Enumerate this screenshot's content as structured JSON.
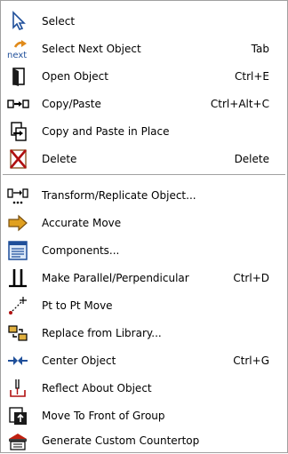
{
  "menu": {
    "items": [
      {
        "label": "Select",
        "shortcut": "",
        "icon": "cursor-arrow-icon"
      },
      {
        "label": "Select Next Object",
        "shortcut": "Tab",
        "icon": "select-next-icon",
        "icon_text": "next"
      },
      {
        "label": "Open Object",
        "shortcut": "Ctrl+E",
        "icon": "open-door-icon"
      },
      {
        "label": "Copy/Paste",
        "shortcut": "Ctrl+Alt+C",
        "icon": "copy-paste-icon"
      },
      {
        "label": "Copy and Paste in Place",
        "shortcut": "",
        "icon": "paste-in-place-icon"
      },
      {
        "label": "Delete",
        "shortcut": "Delete",
        "icon": "delete-icon"
      },
      {
        "label": "Transform/Replicate Object...",
        "shortcut": "",
        "icon": "transform-replicate-icon"
      },
      {
        "label": "Accurate Move",
        "shortcut": "",
        "icon": "arrow-right-icon"
      },
      {
        "label": "Components...",
        "shortcut": "",
        "icon": "components-icon"
      },
      {
        "label": "Make Parallel/Perpendicular",
        "shortcut": "Ctrl+D",
        "icon": "parallel-perpendicular-icon"
      },
      {
        "label": "Pt to Pt Move",
        "shortcut": "",
        "icon": "point-to-point-icon"
      },
      {
        "label": "Replace from Library...",
        "shortcut": "",
        "icon": "replace-library-icon"
      },
      {
        "label": "Center Object",
        "shortcut": "Ctrl+G",
        "icon": "center-object-icon"
      },
      {
        "label": "Reflect About Object",
        "shortcut": "",
        "icon": "reflect-icon"
      },
      {
        "label": "Move To Front of Group",
        "shortcut": "",
        "icon": "move-to-front-icon"
      },
      {
        "label": "Generate Custom Countertop",
        "shortcut": "",
        "icon": "countertop-icon"
      }
    ]
  },
  "colors": {
    "border": "#a0a0a0",
    "accent_orange": "#e08a1a",
    "icon_blue": "#1f4f9a"
  }
}
